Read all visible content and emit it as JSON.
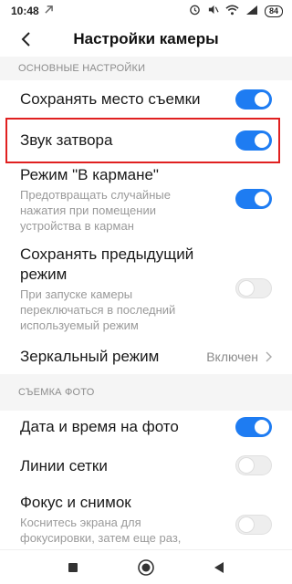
{
  "status_bar": {
    "time": "10:48",
    "battery": "84"
  },
  "header": {
    "title": "Настройки камеры"
  },
  "sections": {
    "basic": {
      "title": "ОСНОВНЫЕ НАСТРОЙКИ",
      "items": {
        "save_location": {
          "label": "Сохранять место съемки",
          "enabled": true
        },
        "shutter_sound": {
          "label": "Звук затвора",
          "enabled": true
        },
        "pocket_mode": {
          "label": "Режим \"В кармане\"",
          "description": "Предотвращать случайные нажатия при помещении устройства в карман",
          "enabled": true
        },
        "save_previous_mode": {
          "label": "Сохранять предыдущий режим",
          "description": "При запуске камеры переключаться в последний используемый режим",
          "enabled": false
        },
        "mirror_mode": {
          "label": "Зеркальный режим",
          "value": "Включен"
        }
      }
    },
    "photo": {
      "title": "СЪЕМКА ФОТО",
      "items": {
        "date_time": {
          "label": "Дата и время на фото",
          "enabled": true
        },
        "grid_lines": {
          "label": "Линии сетки",
          "enabled": false
        },
        "focus_shoot": {
          "label": "Фокус и снимок",
          "description": "Коснитесь экрана для фокусировки, затем еще раз,",
          "enabled": false
        }
      }
    }
  },
  "icons": {
    "back": "back-arrow-icon",
    "alarm": "alarm-icon",
    "mute": "mute-icon",
    "wifi": "wifi-icon",
    "signal": "signal-icon",
    "chevron": "chevron-right-icon",
    "nav_recent": "square-icon",
    "nav_home": "home-circle-icon",
    "nav_back": "triangle-back-icon"
  },
  "colors": {
    "accent": "#1e7cf2",
    "highlight": "#e02020"
  }
}
